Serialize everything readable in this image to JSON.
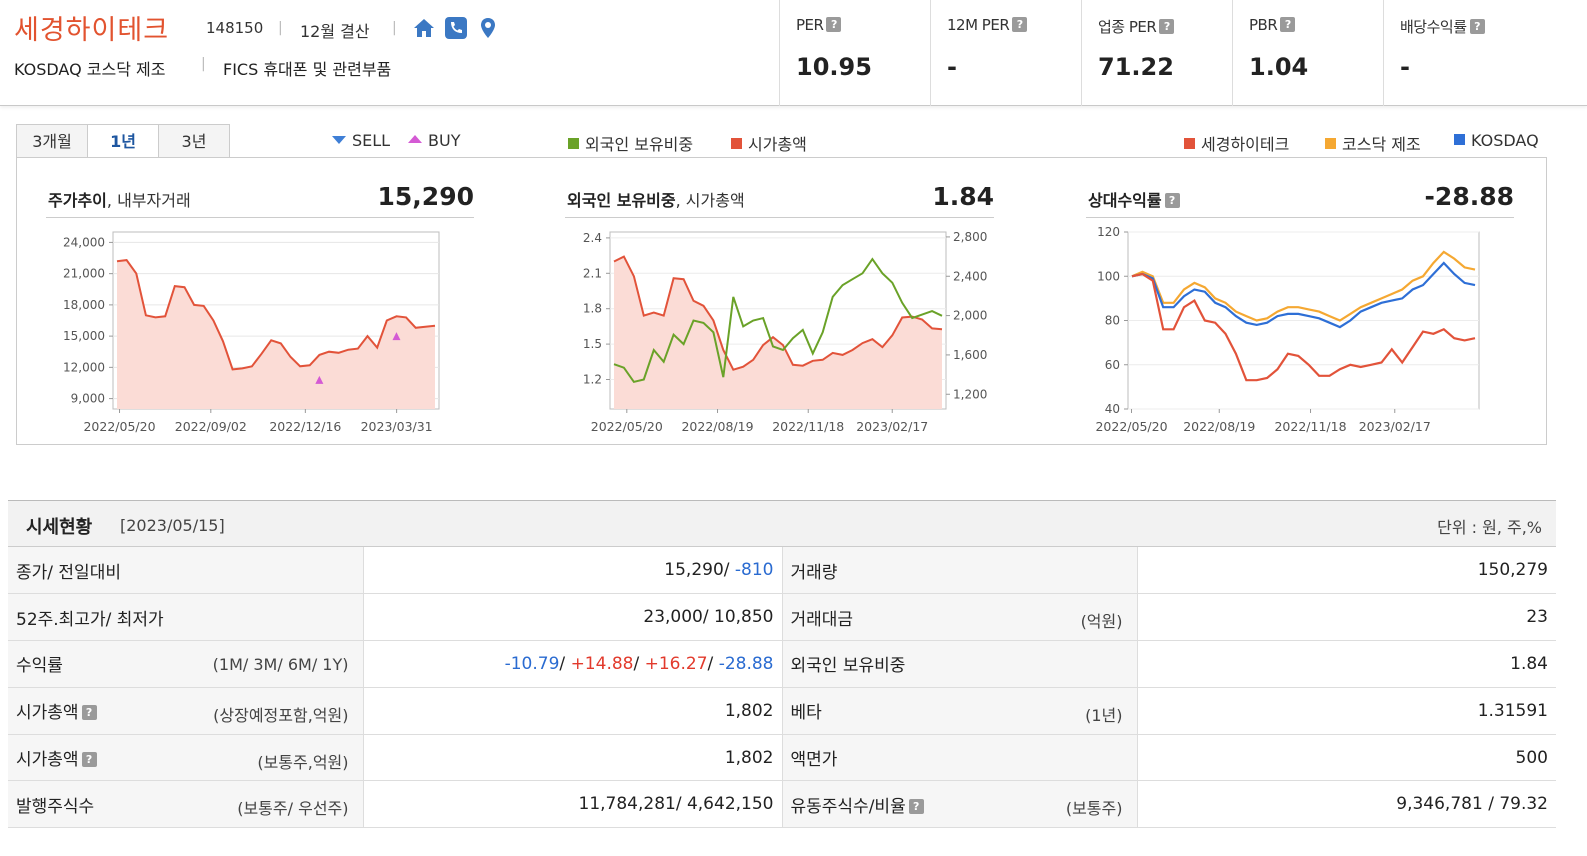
{
  "company": {
    "name": "세경하이테크",
    "code": "148150",
    "fiscal": "12월 결산",
    "market": "KOSDAQ  코스닥 제조",
    "sector": "FICS 휴대폰 및 관련부품",
    "icons": [
      "home-icon",
      "phone-icon",
      "map-pin-icon"
    ]
  },
  "metrics": [
    {
      "label": "PER",
      "value": "10.95"
    },
    {
      "label": "12M PER",
      "value": "-"
    },
    {
      "label": "업종 PER",
      "value": "71.22"
    },
    {
      "label": "PBR",
      "value": "1.04"
    },
    {
      "label": "배당수익률",
      "value": "-"
    }
  ],
  "tabs": [
    "3개월",
    "1년",
    "3년"
  ],
  "active_tab": "1년",
  "legends": {
    "sell": "SELL",
    "buy": "BUY",
    "foreign": "외국인 보유비중",
    "marketcap": "시가총액",
    "company": "세경하이테크",
    "kosdaq_mfg": "코스닥 제조",
    "kosdaq": "KOSDAQ"
  },
  "colors": {
    "brand": "#e2532f",
    "price_line": "#e2533a",
    "price_fill": "#fbdcd6",
    "foreign_line": "#6aa228",
    "sector_line": "#f5a832",
    "kosdaq_line": "#2e6fd6",
    "buy_marker": "#d45ad4",
    "sell_marker": "#3f7fd6"
  },
  "panels": {
    "price": {
      "title_bold": "주가추이",
      "title_rest": ", 내부자거래",
      "value": "15,290"
    },
    "foreign": {
      "title_bold": "외국인 보유비중",
      "title_rest": ", 시가총액",
      "value": "1.84"
    },
    "relative": {
      "title_bold": "상대수익률",
      "title_rest": "",
      "value": "-28.88"
    }
  },
  "chart_data": [
    {
      "type": "area",
      "title": "주가추이, 내부자거래",
      "x_ticks": [
        "2022/05/20",
        "2022/09/02",
        "2022/12/16",
        "2023/03/31"
      ],
      "y_ticks": [
        "24,000",
        "21,000",
        "18,000",
        "15,000",
        "12,000",
        "9,000"
      ],
      "ylim": [
        8000,
        25000
      ],
      "series": [
        {
          "values": [
            22200,
            22300,
            21000,
            17000,
            16800,
            16900,
            19800,
            19700,
            18000,
            17900,
            16500,
            14500,
            11800,
            11900,
            12100,
            13300,
            14600,
            14300,
            13000,
            12100,
            12200,
            13200,
            13500,
            13400,
            13700,
            13800,
            15000,
            13900,
            16500,
            16900,
            16800,
            15800,
            15900,
            16000
          ]
        }
      ],
      "buy_markers": [
        {
          "index": 21,
          "value": 10800
        },
        {
          "index": 29,
          "value": 15000
        }
      ]
    },
    {
      "type": "line",
      "title": "외국인 보유비중, 시가총액",
      "x_ticks": [
        "2022/05/20",
        "2022/08/19",
        "2022/11/18",
        "2023/02/17"
      ],
      "y_ticks": [
        "2.4",
        "2.1",
        "1.8",
        "1.5",
        "1.2"
      ],
      "y2_ticks": [
        "2,800",
        "2,400",
        "2,000",
        "1,600",
        "1,200"
      ],
      "ylim": [
        0.95,
        2.45
      ],
      "y2lim": [
        1050,
        2850
      ],
      "series": [
        {
          "name": "시가총액",
          "axis": "right",
          "values": [
            2550,
            2600,
            2400,
            2000,
            2030,
            2000,
            2380,
            2370,
            2150,
            2100,
            1950,
            1650,
            1450,
            1480,
            1550,
            1700,
            1780,
            1700,
            1500,
            1490,
            1540,
            1550,
            1620,
            1600,
            1650,
            1720,
            1760,
            1680,
            1800,
            1980,
            1990,
            1960,
            1870,
            1860
          ]
        },
        {
          "name": "외국인 보유비중",
          "axis": "left",
          "values": [
            1.33,
            1.3,
            1.18,
            1.2,
            1.45,
            1.35,
            1.58,
            1.5,
            1.7,
            1.68,
            1.6,
            1.22,
            1.9,
            1.65,
            1.7,
            1.72,
            1.48,
            1.45,
            1.55,
            1.62,
            1.42,
            1.6,
            1.9,
            2.0,
            2.05,
            2.1,
            2.22,
            2.1,
            2.02,
            1.85,
            1.72,
            1.75,
            1.78,
            1.74
          ]
        }
      ]
    },
    {
      "type": "line",
      "title": "상대수익률",
      "x_ticks": [
        "2022/05/20",
        "2022/08/19",
        "2022/11/18",
        "2023/02/17"
      ],
      "y_ticks": [
        "120",
        "100",
        "80",
        "60",
        "40"
      ],
      "ylim": [
        40,
        120
      ],
      "series": [
        {
          "name": "코스닥 제조",
          "values": [
            100,
            102,
            100,
            88,
            88,
            94,
            97,
            95,
            90,
            88,
            84,
            82,
            80,
            81,
            84,
            86,
            86,
            85,
            84,
            82,
            80,
            83,
            86,
            88,
            90,
            92,
            94,
            98,
            100,
            106,
            111,
            108,
            104,
            103
          ]
        },
        {
          "name": "KOSDAQ",
          "values": [
            100,
            101,
            99,
            86,
            86,
            91,
            94,
            93,
            88,
            86,
            82,
            79,
            78,
            79,
            82,
            83,
            83,
            82,
            81,
            79,
            77,
            80,
            84,
            86,
            88,
            89,
            90,
            94,
            96,
            101,
            106,
            101,
            97,
            96
          ]
        },
        {
          "name": "세경하이테크",
          "values": [
            100,
            101,
            98,
            76,
            76,
            86,
            89,
            80,
            79,
            74,
            65,
            53,
            53,
            54,
            58,
            65,
            64,
            60,
            55,
            55,
            58,
            60,
            59,
            60,
            61,
            67,
            61,
            68,
            75,
            74,
            76,
            72,
            71,
            72
          ]
        }
      ]
    }
  ],
  "section": {
    "title": "시세현황",
    "date": "[2023/05/15]",
    "unit": "단위 : 원, 주,%"
  },
  "table": {
    "rows": [
      {
        "label": "종가/ 전일대비",
        "sub": "",
        "value_main": "15,290/ ",
        "value_change": "-810",
        "label2": "거래량",
        "sub2": "",
        "value2": "150,279"
      },
      {
        "label": "52주.최고가/ 최저가",
        "sub": "",
        "value_main": "23,000/ 10,850",
        "label2": "거래대금",
        "sub2": "(억원)",
        "value2": "23"
      },
      {
        "label": "수익률",
        "sub": "(1M/ 3M/ 6M/ 1Y)",
        "returns": [
          "-10.79",
          "+14.88",
          "+16.27",
          "-28.88"
        ],
        "label2": "외국인 보유비중",
        "sub2": "",
        "value2": "1.84"
      },
      {
        "label": "시가총액",
        "sub": "(상장예정포함,억원)",
        "value_main": "1,802",
        "label2": "베타",
        "sub2": "(1년)",
        "value2": "1.31591"
      },
      {
        "label": "시가총액",
        "sub": "(보통주,억원)",
        "value_main": "1,802",
        "label2": "액면가",
        "sub2": "",
        "value2": "500"
      },
      {
        "label": "발행주식수",
        "sub": "(보통주/ 우선주)",
        "value_main": "11,784,281/ 4,642,150",
        "label2": "유동주식수/비율",
        "sub2": "(보통주)",
        "value2": "9,346,781 / 79.32"
      }
    ]
  }
}
